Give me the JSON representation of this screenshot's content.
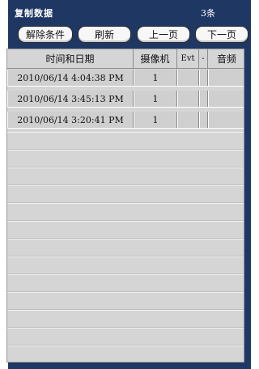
{
  "header": {
    "title": "复制数据",
    "count": "3条"
  },
  "buttons": {
    "clear": "解除条件",
    "refresh": "刷新",
    "prev": "上一页",
    "next": "下一页"
  },
  "table": {
    "columns": [
      "时间和日期",
      "摄像机",
      "Evt",
      "-",
      "音频"
    ],
    "rows": [
      {
        "datetime": "2010/06/14   4:04:38 PM",
        "camera": "1"
      },
      {
        "datetime": "2010/06/14   3:45:13 PM",
        "camera": "1"
      },
      {
        "datetime": "2010/06/14   3:20:41 PM",
        "camera": "1"
      }
    ]
  }
}
